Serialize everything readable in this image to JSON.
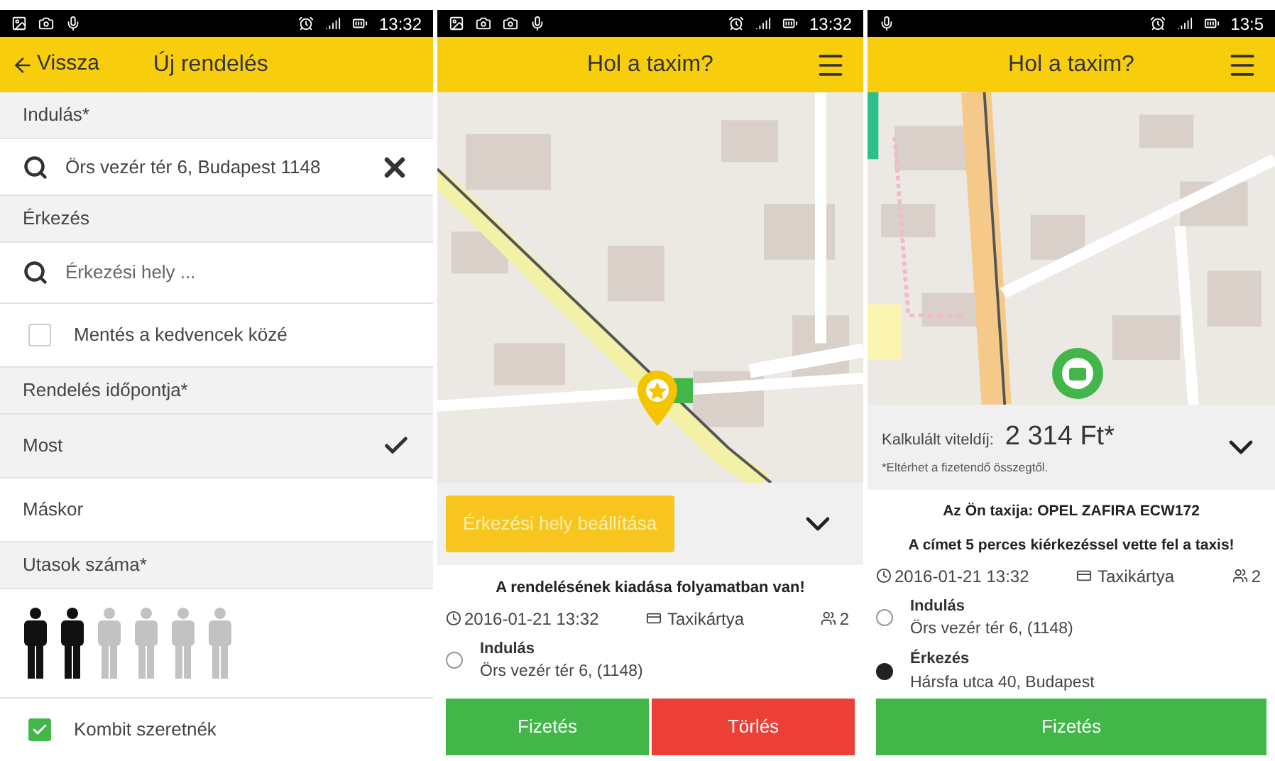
{
  "order_screen": {
    "status_bar": {
      "time": "13:32"
    },
    "header": {
      "back": "Vissza",
      "title": "Új rendelés"
    },
    "departure": {
      "label": "Indulás*",
      "value": "Örs vezér tér 6, Budapest 1148"
    },
    "arrival": {
      "label": "Érkezés",
      "placeholder": "Érkezési hely ..."
    },
    "save_favorite": {
      "label": "Mentés a kedvencek közé",
      "checked": false
    },
    "time": {
      "label": "Rendelés időpontja*",
      "options": [
        {
          "label": "Most",
          "selected": true
        },
        {
          "label": "Máskor",
          "selected": false
        }
      ]
    },
    "passengers": {
      "label": "Utasok száma*",
      "seats": [
        {
          "selected": true
        },
        {
          "selected": true
        },
        {
          "selected": false
        },
        {
          "selected": false
        },
        {
          "selected": false
        },
        {
          "selected": false
        }
      ]
    },
    "combi": {
      "label": "Kombit szeretnék",
      "checked": true
    }
  },
  "waiting_screen": {
    "status_bar": {
      "time": "13:32"
    },
    "header": {
      "title": "Hol a taxim?"
    },
    "set_arrival_button": "Érkezési hely beállítása",
    "status_message": "A rendelésének kiadása folyamatban van!",
    "details": {
      "datetime": "2016-01-21 13:32",
      "payment": "Taxikártya",
      "passengers": "2"
    },
    "stops": [
      {
        "label": "Indulás",
        "address": "Örs vezér tér 6, (1148)",
        "selected": false
      }
    ],
    "buttons": [
      {
        "kind": "pay",
        "label": "Fizetés"
      },
      {
        "kind": "cancel",
        "label": "Törlés"
      }
    ]
  },
  "taxi_screen": {
    "status_bar": {
      "time": "13:5"
    },
    "header": {
      "title": "Hol a taxim?"
    },
    "fare": {
      "label": "Kalkulált viteldíj:",
      "amount": "2 314 Ft*",
      "note": "*Eltérhet a fizetendő összegtől."
    },
    "taxi_message": "Az Ön taxija: OPEL ZAFIRA ECW172",
    "pickup_message": "A címet 5 perces kiérkezéssel vette fel a taxis!",
    "details": {
      "datetime": "2016-01-21 13:32",
      "payment": "Taxikártya",
      "passengers": "2"
    },
    "stops": [
      {
        "label": "Indulás",
        "address": "Örs vezér tér 6, (1148)",
        "selected": false
      },
      {
        "label": "Érkezés",
        "address": "Hársfa utca 40, Budapest",
        "selected": true
      }
    ],
    "buttons": [
      {
        "kind": "pay",
        "label": "Fizetés"
      }
    ]
  }
}
